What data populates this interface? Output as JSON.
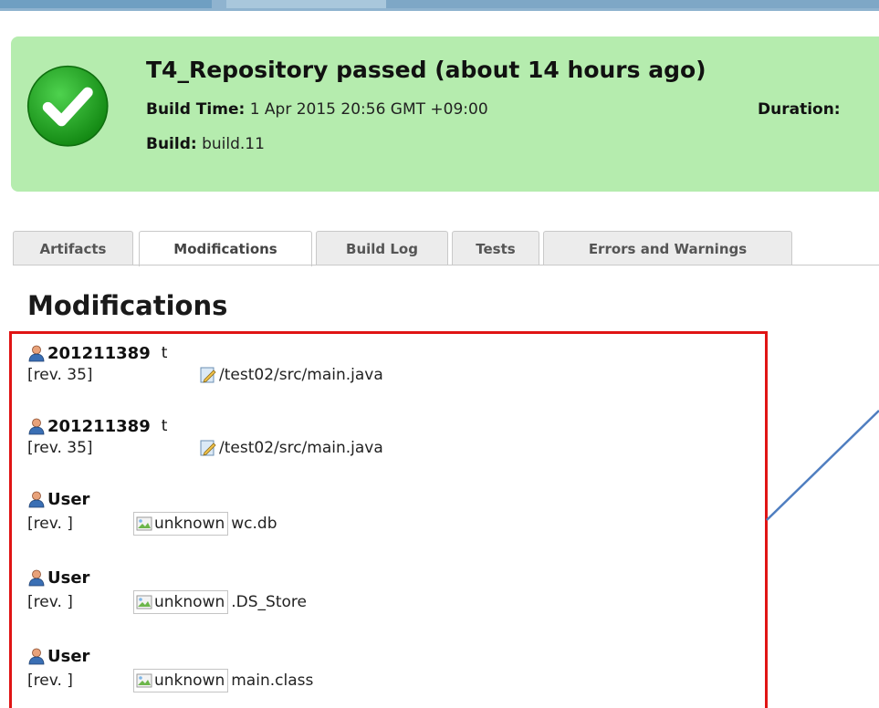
{
  "status": {
    "title": "T4_Repository passed (about 14 hours ago)",
    "build_time_label": "Build Time:",
    "build_time_value": "1 Apr 2015 20:56 GMT +09:00",
    "duration_label": "Duration:",
    "build_label": "Build:",
    "build_value": "build.11",
    "icon": "check-circle-icon",
    "color": "#b5ecae"
  },
  "tabs": [
    {
      "label": "Artifacts"
    },
    {
      "label": "Modifications"
    },
    {
      "label": "Build Log"
    },
    {
      "label": "Tests"
    },
    {
      "label": "Errors and Warnings"
    }
  ],
  "active_tab": "Modifications",
  "section_title": "Modifications",
  "modifications": [
    {
      "user": "201211389",
      "comment": "t",
      "rev": "[rev. 35]",
      "file": "/test02/src/main.java",
      "file_icon": "edit-file-icon"
    },
    {
      "user": "201211389",
      "comment": "t",
      "rev": "[rev. 35]",
      "file": "/test02/src/main.java",
      "file_icon": "edit-file-icon"
    },
    {
      "user": "User",
      "comment": "",
      "rev": "[rev. ]",
      "icon_alt": "unknown",
      "file": "wc.db",
      "file_icon": "broken-image-icon"
    },
    {
      "user": "User",
      "comment": "",
      "rev": "[rev. ]",
      "icon_alt": "unknown",
      "file": ".DS_Store",
      "file_icon": "broken-image-icon"
    },
    {
      "user": "User",
      "comment": "",
      "rev": "[rev. ]",
      "icon_alt": "unknown",
      "file": "main.class",
      "file_icon": "broken-image-icon"
    }
  ],
  "highlight_color": "#e01414",
  "annotation_line_color": "#4f7ec0"
}
